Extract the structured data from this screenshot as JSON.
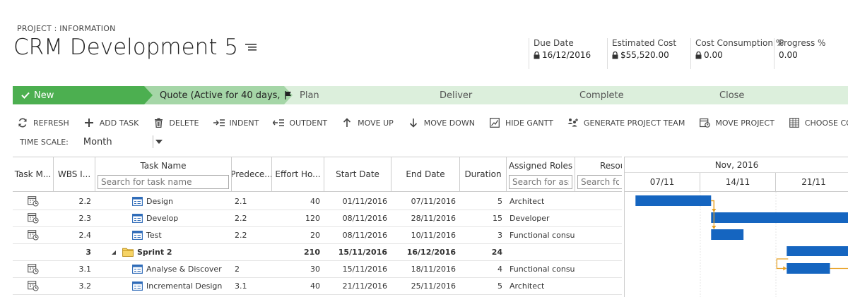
{
  "breadcrumb": "PROJECT : INFORMATION",
  "title": "CRM Development 5",
  "kpis": [
    {
      "label": "Due Date",
      "value": "16/12/2016"
    },
    {
      "label": "Estimated Cost",
      "value": "$55,520.00"
    },
    {
      "label": "Cost Consumption %",
      "value": "0.00"
    },
    {
      "label": "Progress %",
      "value": "0.00"
    }
  ],
  "stages": [
    {
      "label": "New"
    },
    {
      "label": "Quote (Active for 40 days,"
    },
    {
      "label": "Plan"
    },
    {
      "label": "Deliver"
    },
    {
      "label": "Complete"
    },
    {
      "label": "Close"
    }
  ],
  "toolbar": {
    "refresh": "REFRESH",
    "add_task": "ADD TASK",
    "delete": "DELETE",
    "indent": "INDENT",
    "outdent": "OUTDENT",
    "move_up": "MOVE UP",
    "move_down": "MOVE DOWN",
    "hide_gantt": "HIDE GANTT",
    "generate_team": "GENERATE PROJECT TEAM",
    "move_project": "MOVE PROJECT",
    "choose_columns": "CHOOSE COLUMNS"
  },
  "timescale": {
    "label": "TIME SCALE:",
    "value": "Month"
  },
  "columns": {
    "task_mode": "Task M...",
    "wbs": "WBS I...",
    "task_name": "Task Name",
    "task_name_placeholder": "Search for task name",
    "predecessors": "Predece...",
    "effort": "Effort Ho...",
    "start": "Start Date",
    "end": "End Date",
    "duration": "Duration",
    "roles": "Assigned Roles",
    "roles_placeholder": "Search for assigned roles",
    "resources": "Resour...",
    "resources_placeholder": "Search for resources"
  },
  "rows": [
    {
      "wbs": "2.2",
      "name": "Design",
      "pred": "2.1",
      "effort": "40",
      "start": "01/11/2016",
      "end": "07/11/2016",
      "duration": "5",
      "roles": "Architect",
      "summary": false
    },
    {
      "wbs": "2.3",
      "name": "Develop",
      "pred": "2.2",
      "effort": "120",
      "start": "08/11/2016",
      "end": "28/11/2016",
      "duration": "15",
      "roles": "Developer",
      "summary": false
    },
    {
      "wbs": "2.4",
      "name": "Test",
      "pred": "2.2",
      "effort": "20",
      "start": "08/11/2016",
      "end": "10/11/2016",
      "duration": "3",
      "roles": "Functional consu...",
      "summary": false
    },
    {
      "wbs": "3",
      "name": "Sprint 2",
      "pred": "",
      "effort": "210",
      "start": "15/11/2016",
      "end": "16/12/2016",
      "duration": "24",
      "roles": "",
      "summary": true
    },
    {
      "wbs": "3.1",
      "name": "Analyse & Discover",
      "pred": "2",
      "effort": "30",
      "start": "15/11/2016",
      "end": "18/11/2016",
      "duration": "4",
      "roles": "Functional consu...",
      "summary": false
    },
    {
      "wbs": "3.2",
      "name": "Incremental Design",
      "pred": "3.1",
      "effort": "40",
      "start": "21/11/2016",
      "end": "25/11/2016",
      "duration": "5",
      "roles": "Architect",
      "summary": false
    }
  ],
  "gantt": {
    "month": "Nov, 2016",
    "weeks": [
      "07/11",
      "14/11",
      "21/11"
    ],
    "bar_color": "#1565c0",
    "link_color": "#e8a020"
  },
  "colors": {
    "stage_active": "#4caf50",
    "stage_current": "#a5d6a7",
    "stage_future": "#dcefdc"
  }
}
